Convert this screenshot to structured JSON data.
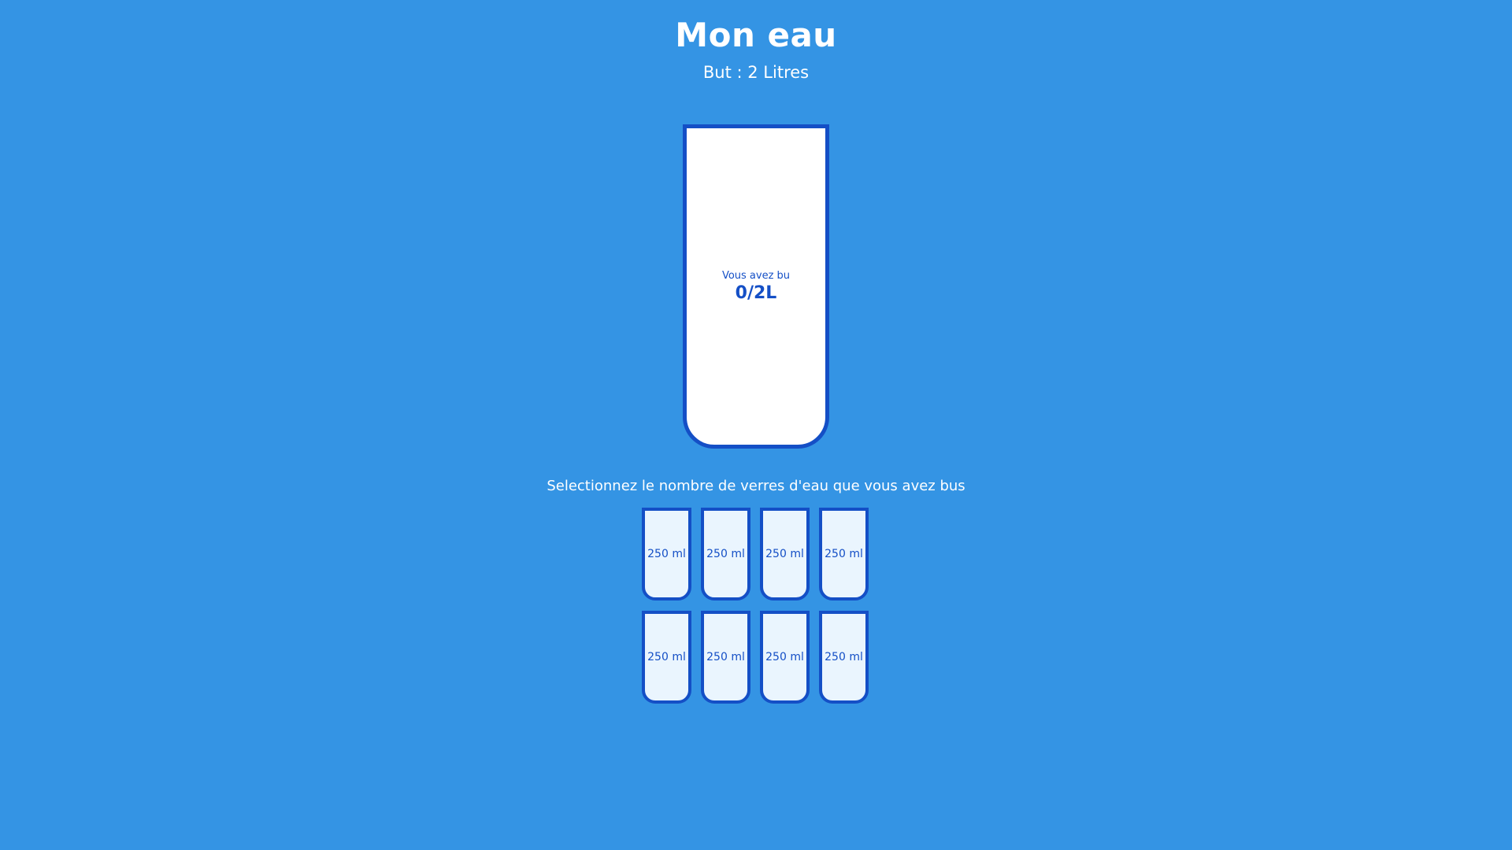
{
  "header": {
    "title": "Mon eau",
    "goal": "But : 2 Litres"
  },
  "big_cup": {
    "drank_label": "Vous avez bu",
    "drank_amount": "0/2L",
    "filled_fraction": 0
  },
  "instruction": "Selectionnez le nombre de verres d'eau que vous avez bus",
  "cups": [
    {
      "label": "250 ml",
      "full": false
    },
    {
      "label": "250 ml",
      "full": false
    },
    {
      "label": "250 ml",
      "full": false
    },
    {
      "label": "250 ml",
      "full": false
    },
    {
      "label": "250 ml",
      "full": false
    },
    {
      "label": "250 ml",
      "full": false
    },
    {
      "label": "250 ml",
      "full": false
    },
    {
      "label": "250 ml",
      "full": false
    }
  ],
  "colors": {
    "background": "#3494e4",
    "cup_border": "#144fc6",
    "cup_fill": "#6ab3f8",
    "small_cup_empty": "#eaf5fe"
  }
}
